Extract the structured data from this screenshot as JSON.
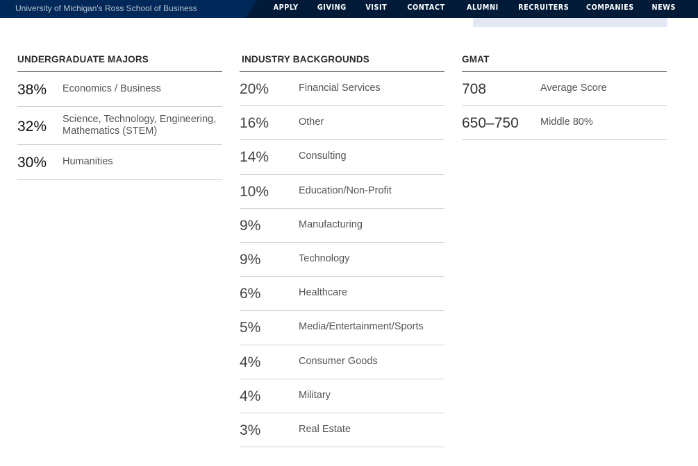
{
  "header": {
    "brand": "University of Michigan's Ross School of Business",
    "nav": [
      "APPLY",
      "GIVING",
      "VISIT",
      "CONTACT",
      "ALUMNI",
      "RECRUITERS",
      "COMPANIES",
      "NEWS"
    ]
  },
  "sections": {
    "majors": {
      "title": "UNDERGRADUATE MAJORS",
      "rows": [
        {
          "value": "38%",
          "label": "Economics / Business"
        },
        {
          "value": "32%",
          "label": "Science, Technology, Engineering, Mathematics (STEM)"
        },
        {
          "value": "30%",
          "label": "Humanities"
        }
      ]
    },
    "industry": {
      "title": "INDUSTRY BACKGROUNDS",
      "rows": [
        {
          "value": "20%",
          "label": "Financial Services"
        },
        {
          "value": "16%",
          "label": "Other"
        },
        {
          "value": "14%",
          "label": "Consulting"
        },
        {
          "value": "10%",
          "label": "Education/Non-Profit"
        },
        {
          "value": "9%",
          "label": "Manufacturing"
        },
        {
          "value": "9%",
          "label": "Technology"
        },
        {
          "value": "6%",
          "label": "Healthcare"
        },
        {
          "value": "5%",
          "label": "Media/Entertainment/Sports"
        },
        {
          "value": "4%",
          "label": "Consumer Goods"
        },
        {
          "value": "4%",
          "label": "Military"
        },
        {
          "value": "3%",
          "label": "Real Estate"
        }
      ]
    },
    "gmat": {
      "title": "GMAT",
      "rows": [
        {
          "value": "708",
          "label": "Average Score"
        },
        {
          "value": "650–750",
          "label": "Middle 80%"
        }
      ]
    }
  }
}
